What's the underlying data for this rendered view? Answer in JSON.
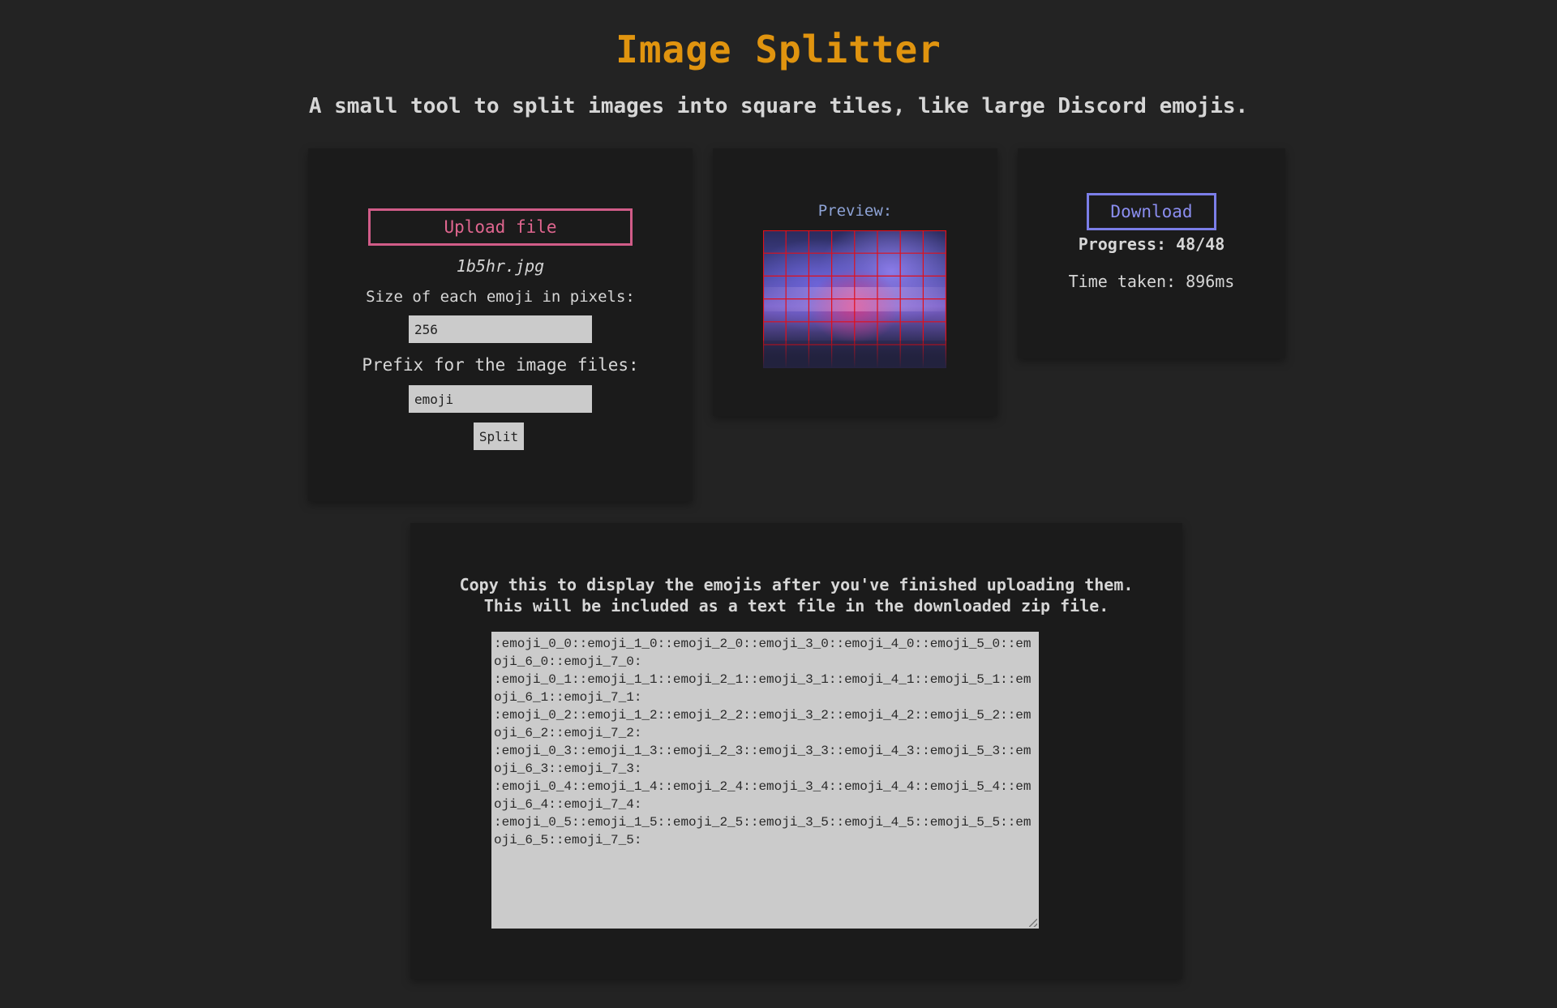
{
  "header": {
    "title": "Image Splitter",
    "subtitle": "A small tool to split images into square tiles, like large Discord emojis."
  },
  "upload": {
    "button_label": "Upload file",
    "filename": "1b5hr.jpg",
    "size_label": "Size of each emoji in pixels:",
    "size_value": "256",
    "prefix_label": "Prefix for the image files:",
    "prefix_value": "emoji",
    "split_label": "Split"
  },
  "preview": {
    "label": "Preview:",
    "grid_columns": 8,
    "grid_rows": 6,
    "grid_color": "#e0101b"
  },
  "download": {
    "button_label": "Download",
    "progress": "Progress: 48/48",
    "time_taken": "Time taken: 896ms"
  },
  "output": {
    "heading_line1": "Copy this to display the emojis after you've finished uploading them.",
    "heading_line2": "This will be included as a text file in the downloaded zip file.",
    "text": ":emoji_0_0::emoji_1_0::emoji_2_0::emoji_3_0::emoji_4_0::emoji_5_0::emoji_6_0::emoji_7_0:\n:emoji_0_1::emoji_1_1::emoji_2_1::emoji_3_1::emoji_4_1::emoji_5_1::emoji_6_1::emoji_7_1:\n:emoji_0_2::emoji_1_2::emoji_2_2::emoji_3_2::emoji_4_2::emoji_5_2::emoji_6_2::emoji_7_2:\n:emoji_0_3::emoji_1_3::emoji_2_3::emoji_3_3::emoji_4_3::emoji_5_3::emoji_6_3::emoji_7_3:\n:emoji_0_4::emoji_1_4::emoji_2_4::emoji_3_4::emoji_4_4::emoji_5_4::emoji_6_4::emoji_7_4:\n:emoji_0_5::emoji_1_5::emoji_2_5::emoji_3_5::emoji_4_5::emoji_5_5::emoji_6_5::emoji_7_5:"
  },
  "colors": {
    "title": "#e0940f",
    "upload_accent": "#d15c88",
    "download_accent": "#7b7ee8",
    "preview_label": "#8ea3d6",
    "background": "#232323",
    "card": "#1b1b1b"
  }
}
